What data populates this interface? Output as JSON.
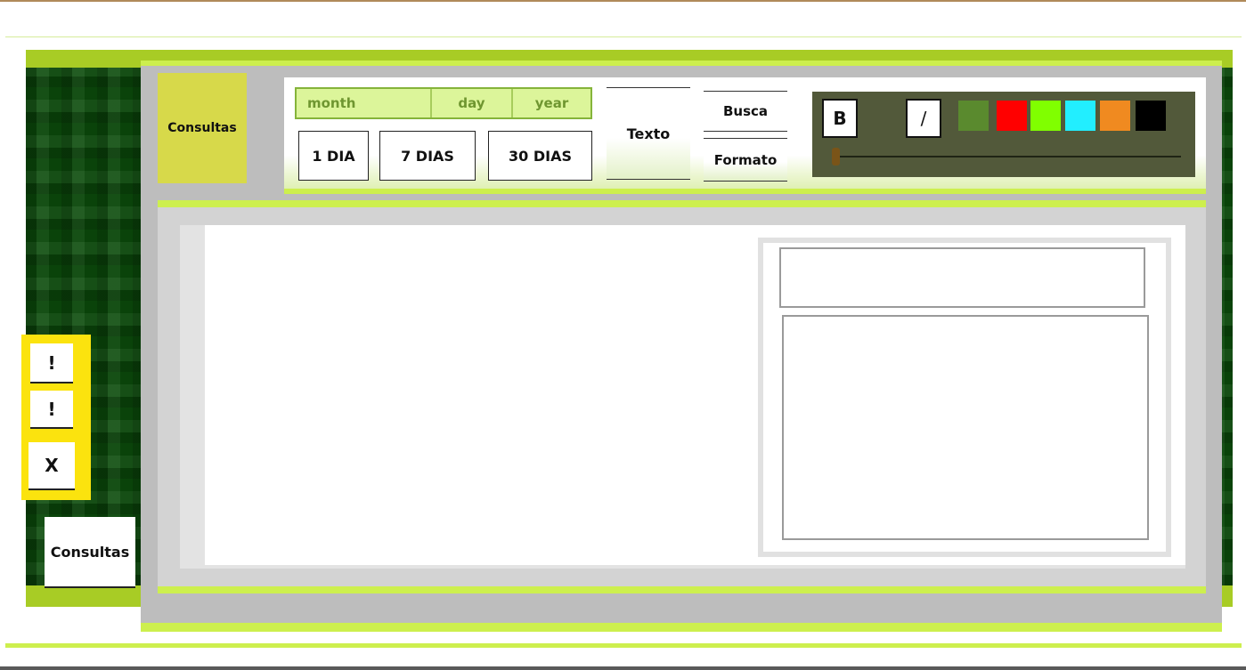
{
  "header": {
    "tile_label": "Consultas"
  },
  "date_picker": {
    "month": "month",
    "day": "day",
    "year": "year"
  },
  "range_buttons": [
    "1 DIA",
    "7 DIAS",
    "30 DIAS"
  ],
  "text_tools": {
    "texto": "Texto",
    "busca": "Busca",
    "formato": "Formato"
  },
  "format": {
    "bold": "B",
    "italic": "/",
    "swatches": [
      "#5a8a2e",
      "#ff0000",
      "#80ff00",
      "#22eeff",
      "#f08a20",
      "#000000"
    ],
    "size_slider_value": 0
  },
  "side_buttons": {
    "alert1": "!",
    "alert2": "!",
    "close": "X"
  },
  "footer": {
    "consultas_label": "Consultas"
  }
}
